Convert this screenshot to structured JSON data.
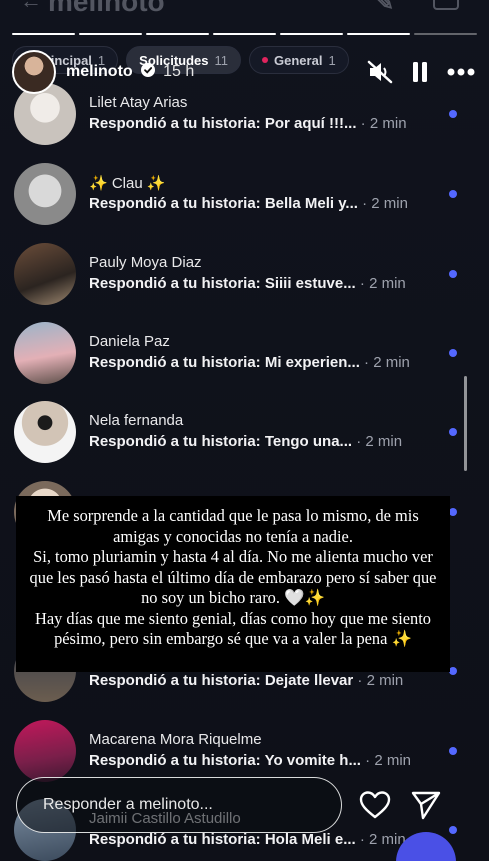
{
  "app_header": {
    "title": "melinoto"
  },
  "tabs": [
    {
      "label": "Principal",
      "count": "1",
      "unread": true,
      "active": false
    },
    {
      "label": "Solicitudes",
      "count": "11",
      "unread": false,
      "active": true
    },
    {
      "label": "General",
      "count": "1",
      "unread": true,
      "active": false
    }
  ],
  "story": {
    "username": "melinoto",
    "time": "15 h",
    "progress_segments_total": 7,
    "progress_segments_done": 6
  },
  "messages": [
    {
      "name": "Lilet Atay Arias",
      "text": "Respondió a tu historia: Por aquí !!!...",
      "time": "2 min",
      "unread": true
    },
    {
      "name": "✨ Clau ✨",
      "text": "Respondió a tu historia: Bella Meli y...",
      "time": "2 min",
      "unread": true
    },
    {
      "name": "Pauly Moya Diaz",
      "text": "Respondió a tu historia: Siiii estuve...",
      "time": "2 min",
      "unread": true
    },
    {
      "name": "Daniela Paz",
      "text": "Respondió a tu historia: Mi experien...",
      "time": "2 min",
      "unread": true
    },
    {
      "name": "Nela fernanda",
      "text": "Respondió a tu historia: Tengo una...",
      "time": "2 min",
      "unread": true
    },
    {
      "name": "",
      "text": "",
      "time": "",
      "unread": true
    },
    {
      "name": "",
      "text": "Respondió a tu historia: Dejate llevar",
      "time": "2 min",
      "unread": true
    },
    {
      "name": "Macarena Mora Riquelme",
      "text": "Respondió a tu historia: Yo vomite h...",
      "time": "2 min",
      "unread": true
    },
    {
      "name": "Jaimii Castillo Astudillo",
      "text": "Respondió a tu historia: Hola Meli e...",
      "time": "2 min",
      "unread": true
    }
  ],
  "caption": {
    "text": "Me sorprende a la cantidad que le pasa lo mismo, de mis amigas y conocidas no tenía a nadie.\nSi, tomo pluriamin y hasta 4 al día. No me alienta mucho ver que les pasó hasta el último día de embarazo pero sí saber que no soy un bicho raro. 🤍✨\nHay días que me siento genial, días como hoy que me siento pésimo, pero sin embargo sé que va a valer la pena ✨"
  },
  "reply": {
    "placeholder": "Responder a melinoto..."
  },
  "icons": {
    "mute": "speaker-muted-icon",
    "pause": "pause-icon",
    "more": "more-horizontal-icon",
    "like": "heart-icon",
    "send": "send-icon",
    "verified": "verified-badge-icon"
  },
  "colors": {
    "unread_dot": "#5468ff",
    "accent_fab": "#4a50e6",
    "tab_unread": "#e0245e"
  }
}
